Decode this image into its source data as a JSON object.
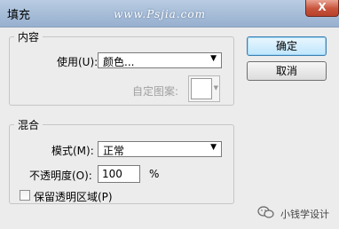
{
  "window": {
    "title": "填充",
    "watermark": "www.Psjia.com",
    "close_label": "X"
  },
  "contents_group": {
    "legend": "内容",
    "use_label": "使用(U):",
    "use_value": "颜色...",
    "custom_pattern_label": "自定图案:"
  },
  "blending_group": {
    "legend": "混合",
    "mode_label": "模式(M):",
    "mode_value": "正常",
    "opacity_label": "不透明度(O):",
    "opacity_value": "100",
    "opacity_unit": "%",
    "preserve_transparency_label": "保留透明区域(P)",
    "preserve_transparency_checked": false
  },
  "buttons": {
    "ok_label": "确定",
    "cancel_label": "取消"
  },
  "branding": {
    "text": "小钱学设计"
  }
}
